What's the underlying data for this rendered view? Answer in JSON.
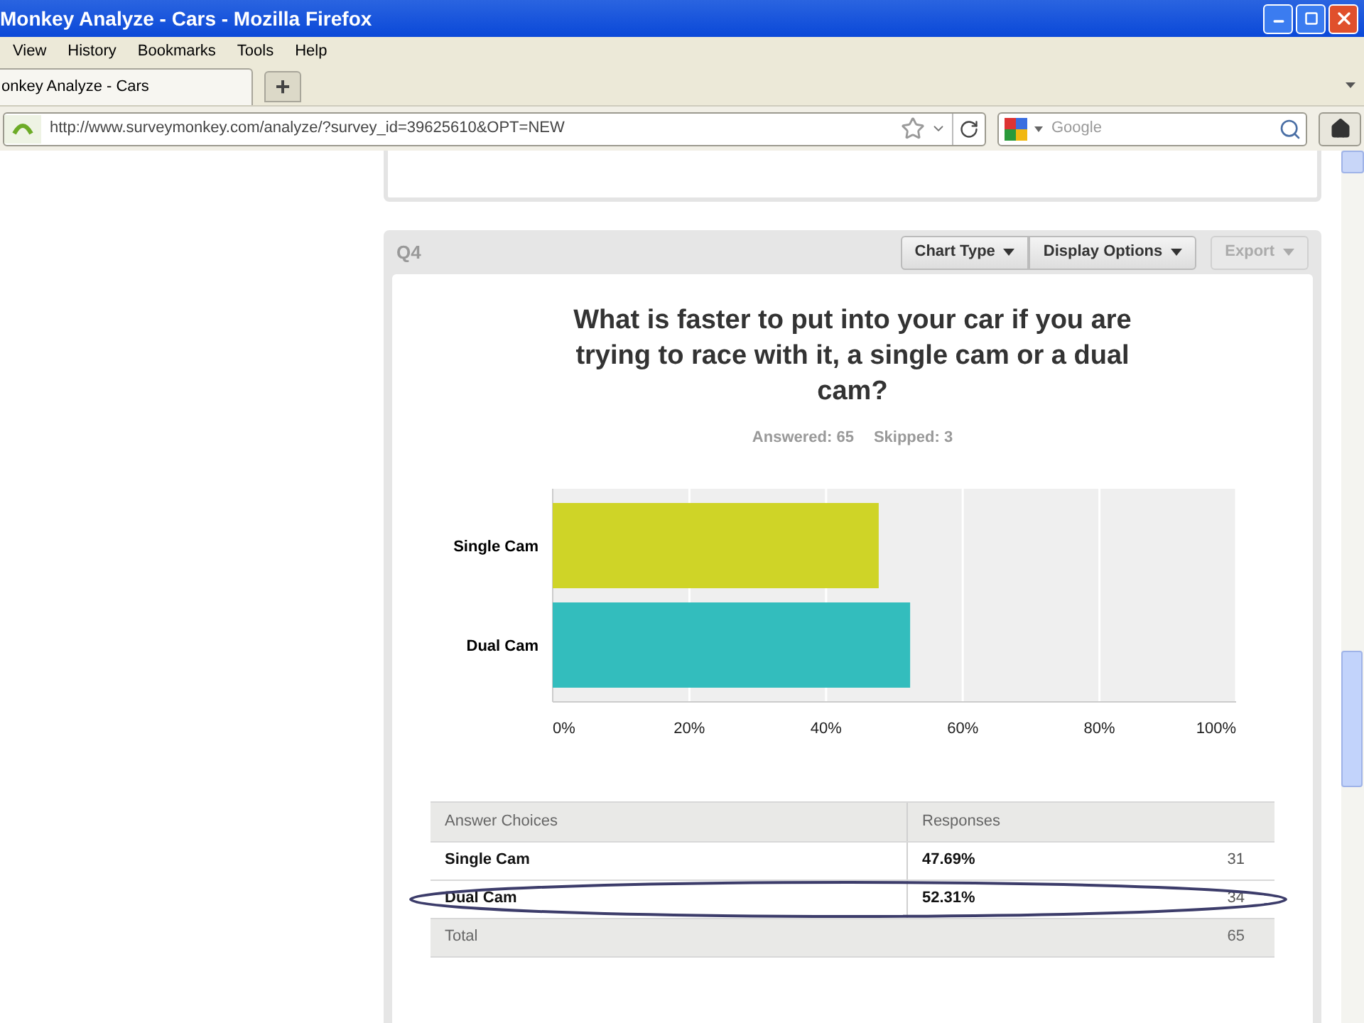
{
  "window": {
    "title": "Monkey Analyze - Cars - Mozilla Firefox"
  },
  "menu": [
    "View",
    "History",
    "Bookmarks",
    "Tools",
    "Help"
  ],
  "tabs": [
    {
      "label": "onkey Analyze - Cars",
      "selected": true
    }
  ],
  "new_tab": "+",
  "address_bar": {
    "url": "http://www.surveymonkey.com/analyze/?survey_id=39625610&OPT=NEW"
  },
  "search": {
    "placeholder": "Google"
  },
  "question": {
    "number": "Q4",
    "buttons": [
      {
        "label": "Chart Type",
        "disabled": false
      },
      {
        "label": "Display Options",
        "disabled": false
      },
      {
        "label": "Export",
        "disabled": true
      }
    ],
    "title": "What is faster to put into your car if you are trying to race with it, a single cam or a dual cam?",
    "answered": "Answered: 65",
    "skipped": "Skipped: 3",
    "chart_data": {
      "type": "bar",
      "orientation": "horizontal",
      "stacked": true,
      "categories": [
        "Single Cam",
        "Dual Cam"
      ],
      "grid": true,
      "series": [
        {
          "color": "#cfd427",
          "values": [
            47.7,
            null
          ]
        },
        {
          "color": "#33bdbd",
          "values": [
            null,
            52.3
          ]
        }
      ],
      "xlim": [
        0,
        100
      ],
      "xticks": [
        {
          "value": 0,
          "label": "0%"
        },
        {
          "value": 20,
          "label": "20%"
        },
        {
          "value": 40,
          "label": "40%"
        },
        {
          "value": 60,
          "label": "60%"
        },
        {
          "value": 80,
          "label": "80%"
        },
        {
          "value": 100,
          "label": "100%"
        }
      ]
    },
    "table": {
      "columns": [
        "Answer Choices",
        "Responses"
      ],
      "rows": [
        {
          "choice": "Single Cam",
          "percent": "47.69%",
          "count": "31",
          "circled": false
        },
        {
          "choice": "Dual Cam",
          "percent": "52.31%",
          "count": "34",
          "circled": true
        }
      ],
      "total": {
        "label": "Total",
        "count": "65"
      }
    }
  }
}
